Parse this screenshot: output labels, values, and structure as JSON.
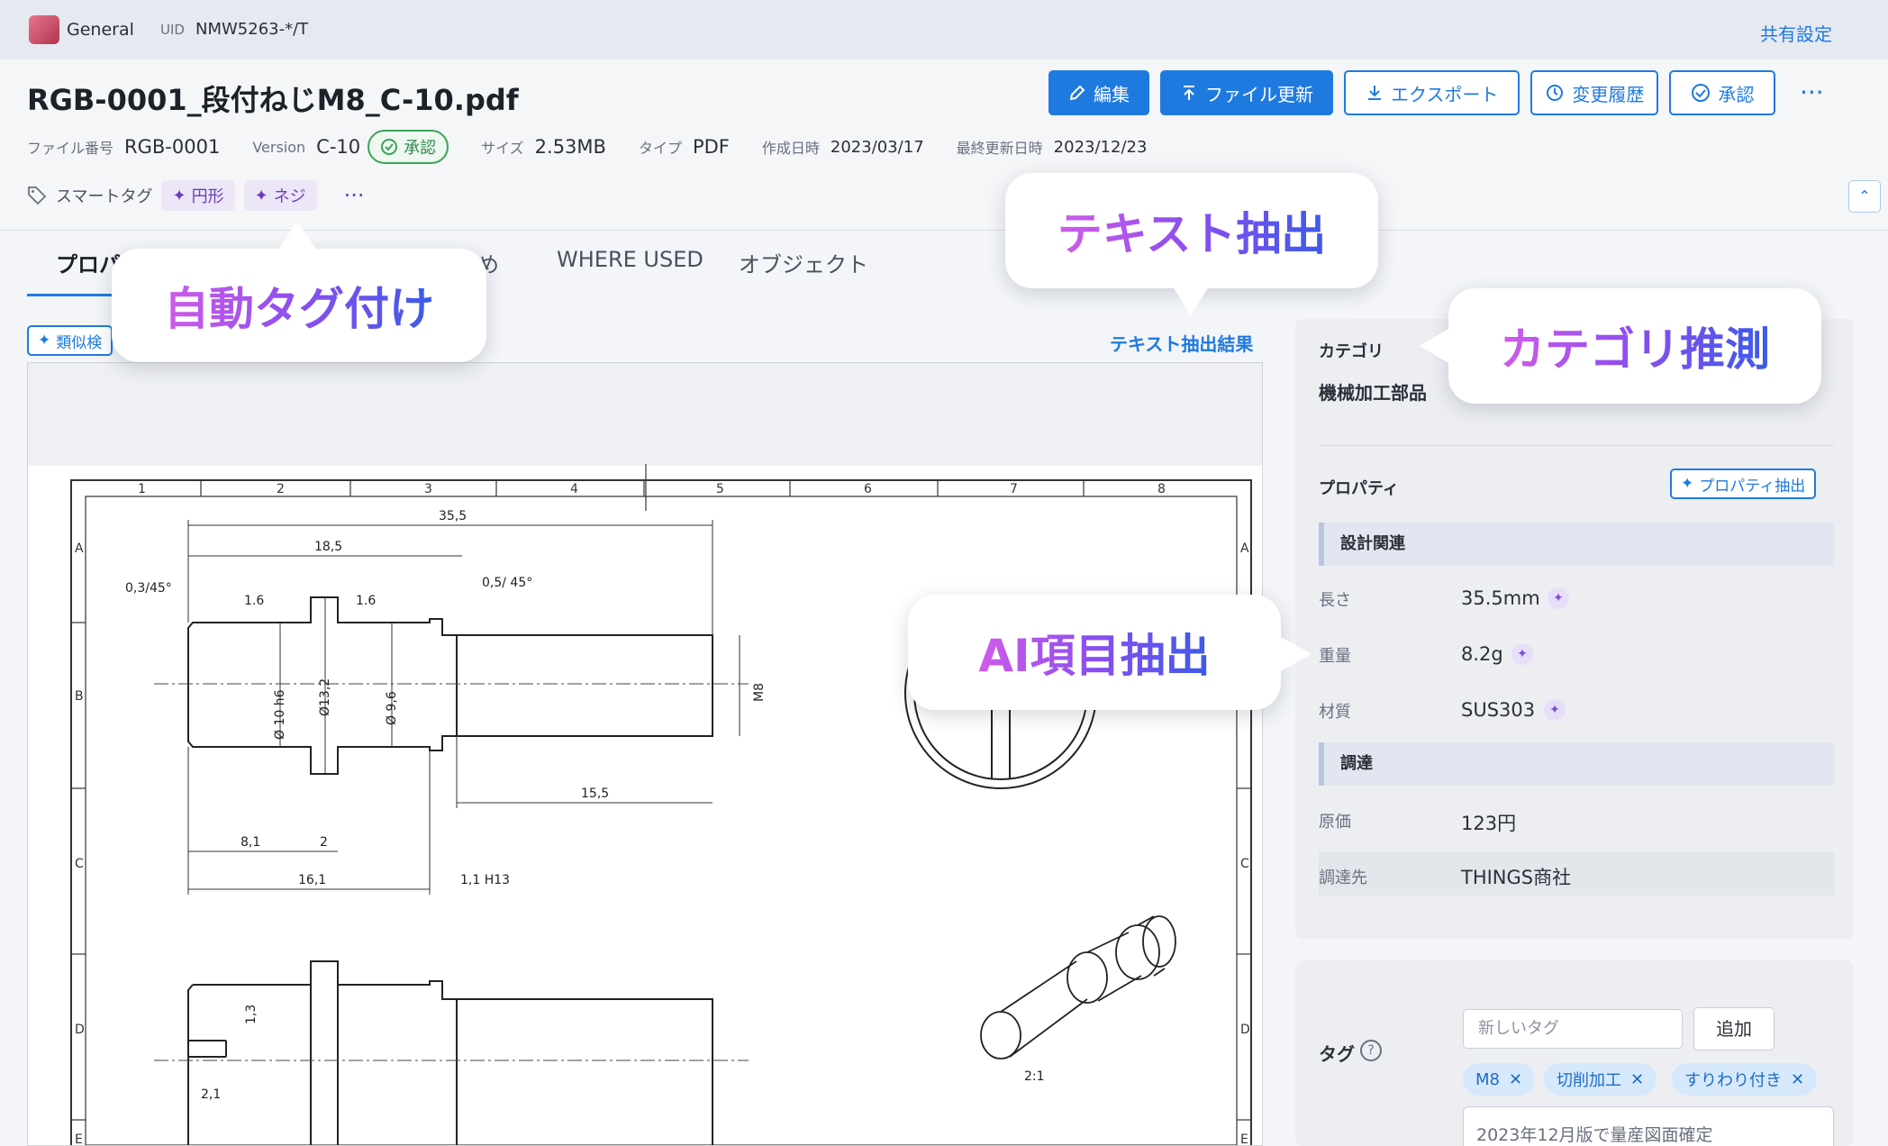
{
  "topbar": {
    "workspace": "General",
    "uid_label": "UID",
    "uid_value": "NMW5263-*/T",
    "share": "共有設定"
  },
  "file": {
    "title": "RGB-0001_段付ねじM8_C-10.pdf",
    "number_label": "ファイル番号",
    "number": "RGB-0001",
    "version_label": "Version",
    "version": "C-10",
    "status": "承認",
    "size_label": "サイズ",
    "size": "2.53MB",
    "type_label": "タイプ",
    "type": "PDF",
    "created_label": "作成日時",
    "created": "2023/03/17",
    "updated_label": "最終更新日時",
    "updated": "2023/12/23"
  },
  "actions": {
    "edit": "編集",
    "update": "ファイル更新",
    "export": "エクスポート",
    "history": "変更履歴",
    "approve": "承認",
    "more": "···"
  },
  "smart_tags": {
    "label": "スマートタグ",
    "items": [
      "円形",
      "ネジ"
    ],
    "more": "···"
  },
  "tabs": [
    "プロパ",
    "め",
    "WHERE USED",
    "オブジェクト"
  ],
  "viewer": {
    "similar": "類似検",
    "text_result": "テキスト抽出結果"
  },
  "drawing": {
    "col_numbers": [
      "1",
      "2",
      "3",
      "4",
      "5",
      "6",
      "7",
      "8"
    ],
    "row_letters": [
      "A",
      "B",
      "C",
      "D",
      "E"
    ],
    "dims": [
      "35,5",
      "18,5",
      "0,3/45°",
      "1.6",
      "1.6",
      "0,5/ 45°",
      "M8",
      "Ø 10 h6",
      "Ø13,2",
      "Ø 9,6",
      "15,5",
      "8,1",
      "2",
      "1,1 H13",
      "16,1",
      "1,3",
      "2,1",
      "2:1"
    ]
  },
  "category": {
    "label": "カテゴリ",
    "value": "機械加工部品"
  },
  "properties": {
    "label": "プロパティ",
    "extract_button": "プロパティ抽出",
    "sections": [
      {
        "title": "設計関連",
        "rows": [
          {
            "key": "長さ",
            "value": "35.5mm"
          },
          {
            "key": "重量",
            "value": "8.2g"
          },
          {
            "key": "材質",
            "value": "SUS303"
          }
        ]
      },
      {
        "title": "調達",
        "rows": [
          {
            "key": "原価",
            "value": "123円"
          },
          {
            "key": "調達先",
            "value": "THINGS商社"
          }
        ]
      }
    ]
  },
  "tags_panel": {
    "label": "タグ",
    "help": "?",
    "placeholder": "新しいタグ",
    "add": "追加",
    "items": [
      "M8",
      "切削加工",
      "すりわり付き"
    ],
    "memo": "2023年12月版で量産図面確定"
  },
  "callouts": {
    "auto_tag": "自動タグ付け",
    "text_extract": "テキスト抽出",
    "category": "カテゴリ推測",
    "ai_extract": "AI項目抽出"
  }
}
